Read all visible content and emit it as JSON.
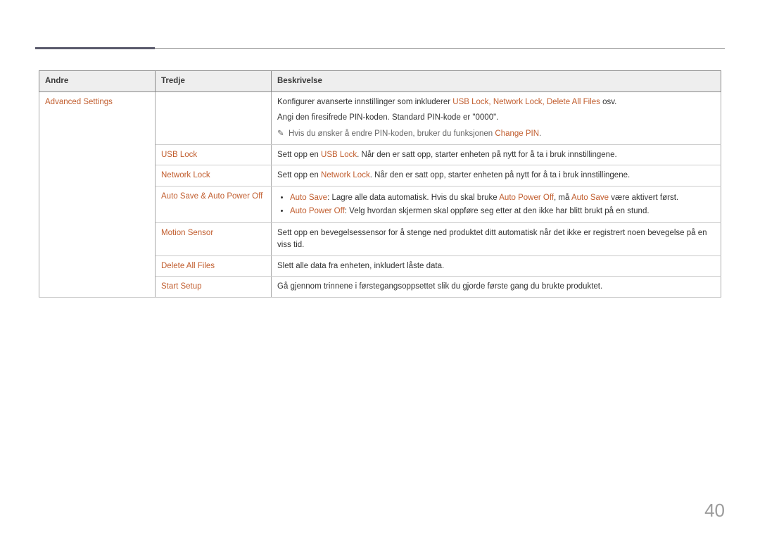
{
  "header": {
    "col_a": "Andre",
    "col_b": "Tredje",
    "col_c": "Beskrivelse"
  },
  "rows": {
    "adv": {
      "a": "Advanced Settings",
      "c_line1_pre": "Konfigurer avanserte innstillinger som inkluderer ",
      "c_line1_hl": "USB Lock, Network Lock, Delete All Files",
      "c_line1_post": " osv.",
      "c_line2": "Angi den firesifrede PIN-koden. Standard PIN-kode er \"0000\".",
      "c_note_pre": "Hvis du ønsker å endre PIN-koden, bruker du funksjonen ",
      "c_note_hl": "Change PIN",
      "c_note_post": "."
    },
    "usb": {
      "b": "USB Lock",
      "c_pre": "Sett opp en ",
      "c_hl": "USB Lock",
      "c_post": ". Når den er satt opp, starter enheten på nytt for å ta i bruk innstillingene."
    },
    "net": {
      "b": "Network Lock",
      "c_pre": "Sett opp en ",
      "c_hl": "Network Lock",
      "c_post": ". Når den er satt opp, starter enheten på nytt for å ta i bruk innstillingene."
    },
    "auto": {
      "b": "Auto Save & Auto Power Off",
      "li1_hl1": "Auto Save",
      "li1_mid": ": Lagre alle data automatisk. Hvis du skal bruke ",
      "li1_hl2": "Auto Power Off",
      "li1_mid2": ", må ",
      "li1_hl3": "Auto Save",
      "li1_end": " være aktivert først.",
      "li2_hl": "Auto Power Off",
      "li2_rest": ": Velg hvordan skjermen skal oppføre seg etter at den ikke har blitt brukt på en stund."
    },
    "motion": {
      "b": "Motion Sensor",
      "c": "Sett opp en bevegelsessensor for å stenge ned produktet ditt automatisk når det ikke er registrert noen bevegelse på en viss tid."
    },
    "del": {
      "b": "Delete All Files",
      "c": "Slett alle data fra enheten, inkludert låste data."
    },
    "start": {
      "b": "Start Setup",
      "c": "Gå gjennom trinnene i førstegangsoppsettet slik du gjorde første gang du brukte produktet."
    }
  },
  "note_icon": "✎",
  "page_number": "40"
}
